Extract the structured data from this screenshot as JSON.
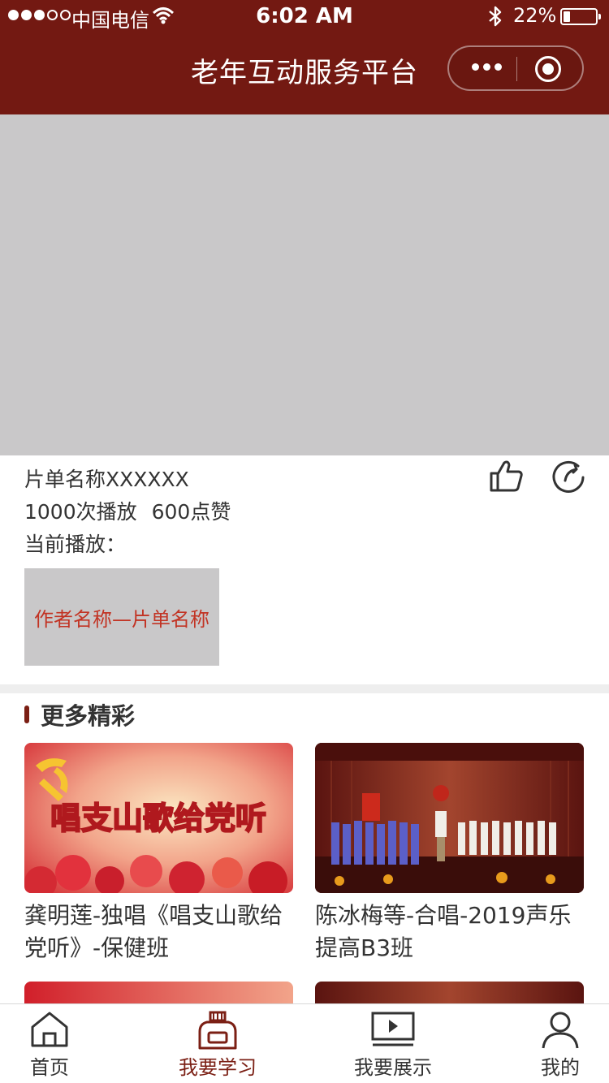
{
  "status_bar": {
    "carrier": "中国电信",
    "time": "6:02 AM",
    "battery": "22%",
    "signal_bars_filled": 3,
    "signal_bars_total": 5
  },
  "nav": {
    "title": "老年互动服务平台"
  },
  "playlist": {
    "name": "片单名称XXXXXX",
    "plays": "1000次播放",
    "likes": "600点赞",
    "current_label": "当前播放：",
    "current_item": "作者名称—片单名称"
  },
  "more_section": {
    "title": "更多精彩",
    "cards": [
      {
        "caption": "龚明莲-独唱《唱支山歌给党听》-保健班",
        "banner_text": "唱支山歌给党听"
      },
      {
        "caption": "陈冰梅等-合唱-2019声乐提高B3班"
      }
    ]
  },
  "tabbar": {
    "items": [
      {
        "label": "首页",
        "icon": "home-icon"
      },
      {
        "label": "我要学习",
        "icon": "ink-bottle-icon",
        "active": true
      },
      {
        "label": "我要展示",
        "icon": "video-screen-icon"
      },
      {
        "label": "我的",
        "icon": "person-icon"
      }
    ]
  },
  "colors": {
    "brand": "#731912",
    "accent_text": "#c23323",
    "placeholder": "#c9c8c9"
  }
}
